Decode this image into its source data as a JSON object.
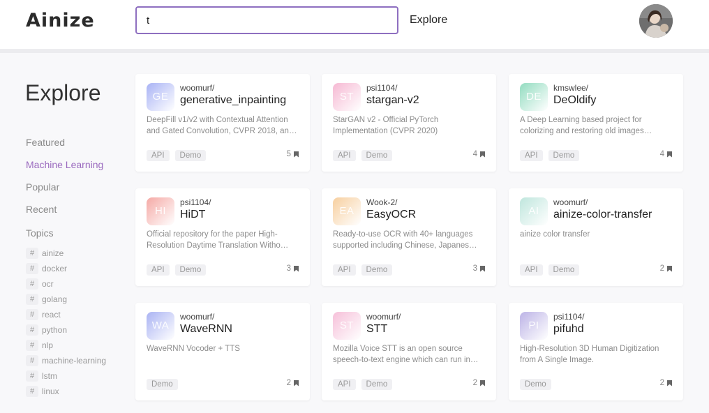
{
  "header": {
    "logo": "Ainize",
    "search_value": "t",
    "explore_label": "Explore"
  },
  "sidebar": {
    "title": "Explore",
    "nav": [
      {
        "label": "Featured",
        "active": false
      },
      {
        "label": "Machine Learning",
        "active": true
      },
      {
        "label": "Popular",
        "active": false
      },
      {
        "label": "Recent",
        "active": false
      }
    ],
    "topics_heading": "Topics",
    "topics": [
      "ainize",
      "docker",
      "ocr",
      "golang",
      "react",
      "python",
      "nlp",
      "machine-learning",
      "lstm",
      "linux"
    ]
  },
  "cards": [
    {
      "icon": "GE",
      "icon_color": "#a9b3f5",
      "owner": "woomurf/",
      "repo": "generative_inpainting",
      "desc": "DeepFill v1/v2 with Contextual Attention and Gated Convolution, CVPR 2018, an…",
      "tags": [
        "API",
        "Demo"
      ],
      "count": "5"
    },
    {
      "icon": "ST",
      "icon_color": "#f6b9d3",
      "owner": "psi1104/",
      "repo": "stargan-v2",
      "desc": "StarGAN v2 - Official PyTorch Implementation (CVPR 2020)",
      "tags": [
        "API",
        "Demo"
      ],
      "count": "4"
    },
    {
      "icon": "DE",
      "icon_color": "#93dcc0",
      "owner": "kmswlee/",
      "repo": "DeOldify",
      "desc": "A Deep Learning based project for colorizing and restoring old images…",
      "tags": [
        "API",
        "Demo"
      ],
      "count": "4"
    },
    {
      "icon": "HI",
      "icon_color": "#f5a9a5",
      "owner": "psi1104/",
      "repo": "HiDT",
      "desc": "Official repository for the paper High-Resolution Daytime Translation Witho…",
      "tags": [
        "API",
        "Demo"
      ],
      "count": "3"
    },
    {
      "icon": "EA",
      "icon_color": "#f7cf9f",
      "owner": "Wook-2/",
      "repo": "EasyOCR",
      "desc": "Ready-to-use OCR with 40+ languages supported including Chinese, Japanes…",
      "tags": [
        "API",
        "Demo"
      ],
      "count": "3"
    },
    {
      "icon": "AI",
      "icon_color": "#bfe6dd",
      "owner": "woomurf/",
      "repo": "ainize-color-transfer",
      "desc": "ainize color transfer",
      "tags": [
        "API",
        "Demo"
      ],
      "count": "2"
    },
    {
      "icon": "WA",
      "icon_color": "#aab3f3",
      "owner": "woomurf/",
      "repo": "WaveRNN",
      "desc": "WaveRNN Vocoder + TTS",
      "tags": [
        "Demo"
      ],
      "count": "2"
    },
    {
      "icon": "ST",
      "icon_color": "#f6c0d9",
      "owner": "woomurf/",
      "repo": "STT",
      "desc": "Mozilla Voice STT is an open source speech-to-text engine which can run in…",
      "tags": [
        "API",
        "Demo"
      ],
      "count": "2"
    },
    {
      "icon": "PI",
      "icon_color": "#bcb3e6",
      "owner": "psi1104/",
      "repo": "pifuhd",
      "desc": "High-Resolution 3D Human Digitization from A Single Image.",
      "tags": [
        "Demo"
      ],
      "count": "2"
    }
  ]
}
